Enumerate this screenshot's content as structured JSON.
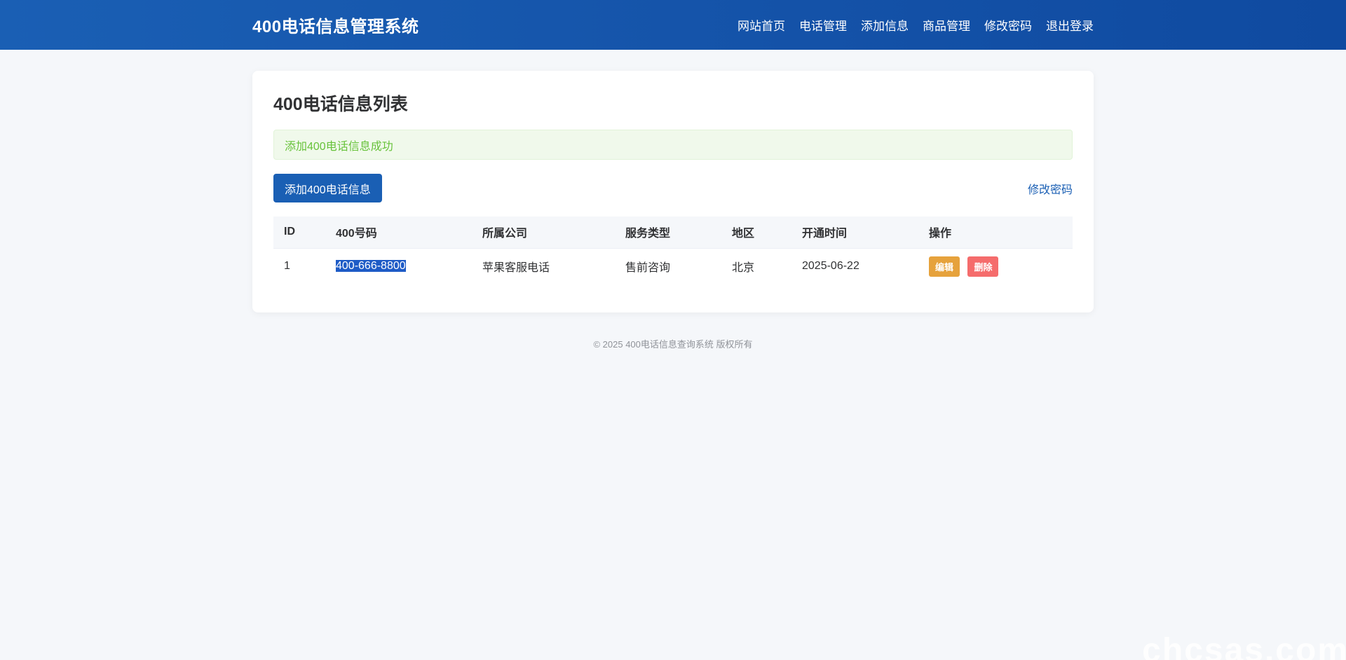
{
  "header": {
    "brand": "400电话信息管理系统",
    "nav": [
      "网站首页",
      "电话管理",
      "添加信息",
      "商品管理",
      "修改密码",
      "退出登录"
    ]
  },
  "main": {
    "title": "400电话信息列表",
    "alert": "添加400电话信息成功",
    "add_button": "添加400电话信息",
    "change_password_link": "修改密码",
    "table": {
      "headers": [
        "ID",
        "400号码",
        "所属公司",
        "服务类型",
        "地区",
        "开通时间",
        "操作"
      ],
      "rows": [
        {
          "id": "1",
          "number": "400-666-8800",
          "company": "苹果客服电话",
          "service": "售前咨询",
          "region": "北京",
          "date": "2025-06-22",
          "edit": "编辑",
          "delete": "删除"
        }
      ]
    }
  },
  "footer": "© 2025 400电话信息查询系统 版权所有",
  "watermark": "chcsas.com",
  "colors": {
    "primary": "#1a5fb4",
    "success_text": "#67c23a",
    "warning": "#e6a23c",
    "danger": "#f56c6c"
  }
}
